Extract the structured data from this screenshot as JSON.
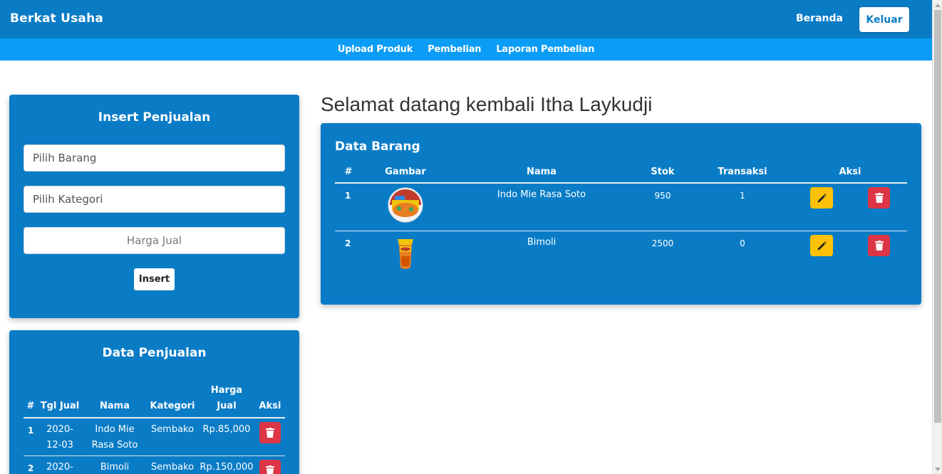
{
  "navbar": {
    "brand": "Berkat Usaha",
    "beranda": "Beranda",
    "keluar": "Keluar"
  },
  "subnav": [
    "Upload Produk",
    "Pembelian",
    "Laporan Pembelian"
  ],
  "insert_form": {
    "title": "Insert Penjualan",
    "barang_placeholder": "Pilih Barang",
    "kategori_placeholder": "Pilih Kategori",
    "harga_placeholder": "Harga Jual",
    "insert_button": "Insert"
  },
  "welcome": "Selamat datang kembali Itha Laykudji",
  "data_barang": {
    "title": "Data Barang",
    "columns": [
      "#",
      "Gambar",
      "Nama",
      "Stok",
      "Transaksi",
      "Aksi"
    ],
    "rows": [
      {
        "no": "1",
        "nama": "Indo Mie Rasa Soto",
        "stok": "950",
        "transaksi": "1",
        "image": "indomie-product-image"
      },
      {
        "no": "2",
        "nama": "Bimoli",
        "stok": "2500",
        "transaksi": "0",
        "image": "bimoli-product-image"
      }
    ]
  },
  "data_penjualan": {
    "title": "Data Penjualan",
    "columns": [
      "#",
      "Tgl Jual",
      "Nama",
      "Kategori",
      "Harga\nJual",
      "Aksi"
    ],
    "rows": [
      {
        "no": "1",
        "tgl": "2020-12-03",
        "nama": "Indo Mie Rasa Soto",
        "kategori": "Sembako",
        "harga": "Rp.85,000"
      },
      {
        "no": "2",
        "tgl": "2020-",
        "nama": "Bimoli",
        "kategori": "Sembako",
        "harga": "Rp.150,000"
      }
    ]
  },
  "icons": {
    "edit": "pencil-icon",
    "delete": "trash-icon"
  },
  "colors": {
    "primary": "#0a7cc6",
    "subnav": "#0b9cf5",
    "edit": "#ffc107",
    "delete": "#dc3545"
  }
}
